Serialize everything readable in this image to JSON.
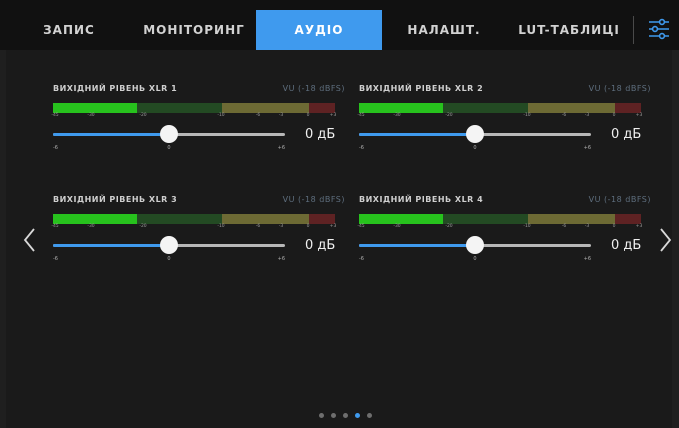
{
  "tabs": [
    {
      "label": "ЗАПИС",
      "active": false
    },
    {
      "label": "МОНІТОРИНГ",
      "active": false
    },
    {
      "label": "АУДІО",
      "active": true
    },
    {
      "label": "НАЛАШТ.",
      "active": false
    },
    {
      "label": "LUT-ТАБЛИЦІ",
      "active": false
    }
  ],
  "settings_icon": "sliders-settings-icon",
  "nav": {
    "prev_icon": "chevron-left-icon",
    "next_icon": "chevron-right-icon"
  },
  "meter_scale": [
    "-45",
    "-30",
    "-20",
    "-10",
    "-6",
    "-3",
    "0",
    "+3"
  ],
  "slider_scale": [
    "-6",
    "0",
    "+6"
  ],
  "channels": [
    {
      "title": "ВИХІДНИЙ РІВЕНЬ XLR 1",
      "scale_label": "VU (-18 dBFS)",
      "value": "0 дБ",
      "level": 0.5
    },
    {
      "title": "ВИХІДНИЙ РІВЕНЬ XLR 2",
      "scale_label": "VU (-18 dBFS)",
      "value": "0 дБ",
      "level": 0.5
    },
    {
      "title": "ВИХІДНИЙ РІВЕНЬ XLR 3",
      "scale_label": "VU (-18 dBFS)",
      "value": "0 дБ",
      "level": 0.5
    },
    {
      "title": "ВИХІДНИЙ РІВЕНЬ XLR 4",
      "scale_label": "VU (-18 dBFS)",
      "value": "0 дБ",
      "level": 0.5
    }
  ],
  "pagination": {
    "count": 5,
    "active": 4
  },
  "colors": {
    "accent": "#3f9aee",
    "meter_green_lit": "#27c21d",
    "meter_green_dim": "#234a23",
    "meter_yellow_dim": "#6d6a34",
    "meter_red_dim": "#5e2223"
  }
}
